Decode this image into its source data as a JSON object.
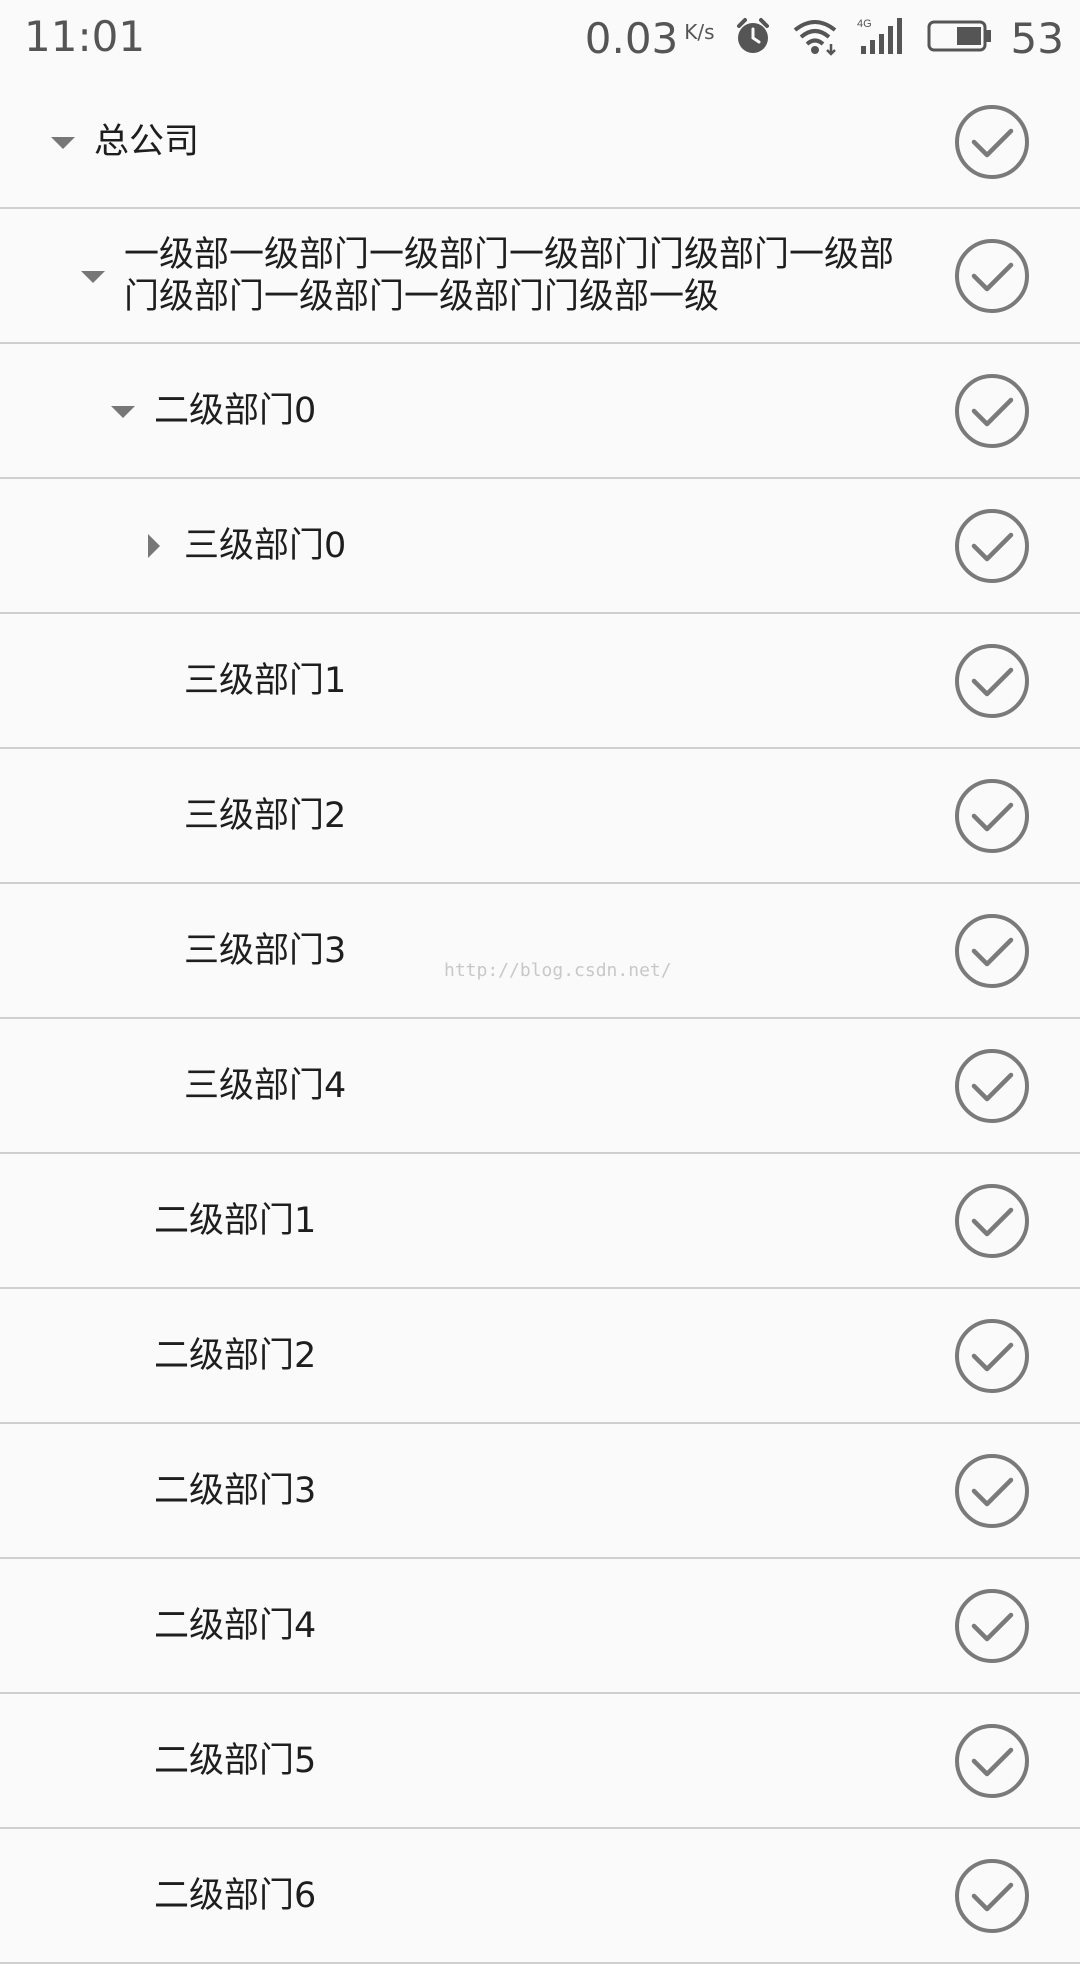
{
  "status_bar": {
    "time": "11:01",
    "net_speed": "0.03",
    "net_unit": "K/s",
    "battery": "53",
    "icons": [
      "alarm-icon",
      "wifi-icon",
      "4g-signal-icon",
      "battery-icon"
    ]
  },
  "tree": {
    "rows": [
      {
        "label": "总公司",
        "arrow": "down"
      },
      {
        "label": "一级部一级部门一级部门一级部门门级部门一级部门级部门一级部门一级部门门级部一级",
        "arrow": "down"
      },
      {
        "label": "二级部门0",
        "arrow": "down"
      },
      {
        "label": "三级部门0",
        "arrow": "right"
      },
      {
        "label": "三级部门1",
        "arrow": "none"
      },
      {
        "label": "三级部门2",
        "arrow": "none"
      },
      {
        "label": "三级部门3",
        "arrow": "none"
      },
      {
        "label": "三级部门4",
        "arrow": "none"
      },
      {
        "label": "二级部门1",
        "arrow": "none"
      },
      {
        "label": "二级部门2",
        "arrow": "none"
      },
      {
        "label": "二级部门3",
        "arrow": "none"
      },
      {
        "label": "二级部门4",
        "arrow": "none"
      },
      {
        "label": "二级部门5",
        "arrow": "none"
      },
      {
        "label": "二级部门6",
        "arrow": "none"
      }
    ]
  },
  "watermark": "http://blog.csdn.net/",
  "colors": {
    "background": "#fafafa",
    "divider": "#cfcfcf",
    "check_icon": "#7a7a7a",
    "arrow": "#777777",
    "text": "#1e1e1e"
  }
}
